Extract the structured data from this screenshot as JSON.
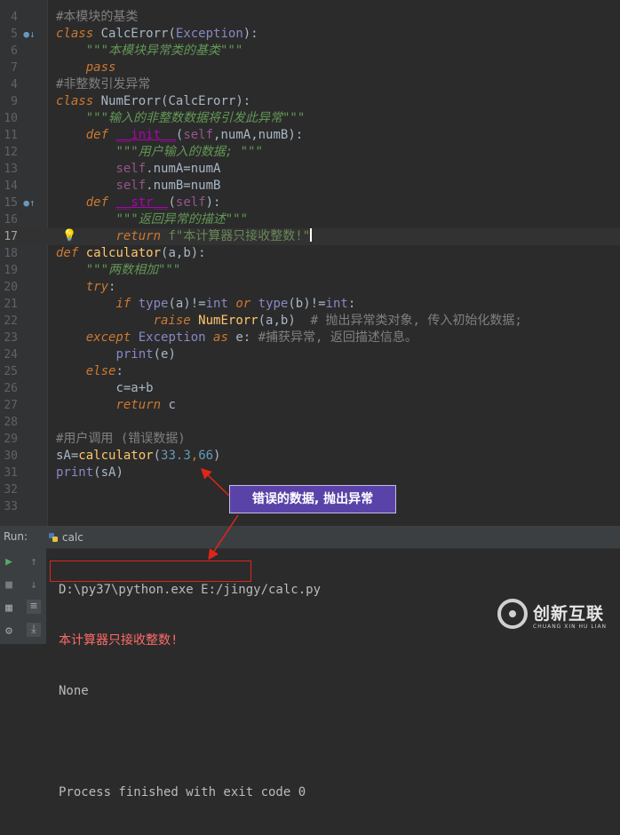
{
  "editor": {
    "line_numbers": [
      "4",
      "5",
      "6",
      "7",
      "4",
      "9",
      "10",
      "11",
      "12",
      "13",
      "14",
      "15",
      "16",
      "17",
      "18",
      "19",
      "20",
      "21",
      "22",
      "23",
      "24",
      "25",
      "26",
      "27",
      "28",
      "29",
      "30",
      "31",
      "32",
      "33"
    ],
    "lines": {
      "l0": {
        "c1": "#本模块的基类"
      },
      "l1": {
        "kw": "class",
        "name": "CalcErorr",
        "p1": "(",
        "base": "Exception",
        "p2": "):"
      },
      "l2": {
        "doc": "\"\"\"本模块异常类的基类\"\"\""
      },
      "l3": {
        "kw": "pass"
      },
      "l4": {
        "c1": "#非整数引发异常"
      },
      "l5": {
        "kw": "class",
        "name": "NumErorr",
        "rest": "(CalcErorr):"
      },
      "l6": {
        "doc": "\"\"\"输入的非整数数据将引发此异常\"\"\""
      },
      "l7": {
        "kw": "def",
        "fn": "__init__",
        "p1": "(",
        "self": "self",
        "rest": ",numA,numB):"
      },
      "l8": {
        "doc": "\"\"\"用户输入的数据; \"\"\""
      },
      "l9": {
        "self": "self",
        "rest": ".numA=numA"
      },
      "l10": {
        "self": "self",
        "rest": ".numB=numB"
      },
      "l11": {
        "kw": "def",
        "fn": "__str__",
        "p1": "(",
        "self": "self",
        "rest": "):"
      },
      "l12": {
        "doc": "\"\"\"返回异常的描述\"\"\""
      },
      "l13": {
        "kw": "return",
        "str": "f\"本计算器只接收整数!\""
      },
      "l14": {
        "kw": "def",
        "fn": "calculator",
        "rest": "(a,b):"
      },
      "l15": {
        "doc": "\"\"\"两数相加\"\"\""
      },
      "l16": {
        "kw": "try",
        "rest": ":"
      },
      "l17": {
        "kw": "if",
        "b1": "type",
        "r1": "(a)!=",
        "b2": "int",
        "kw2": "or",
        "b3": "type",
        "r2": "(b)!=",
        "b4": "int",
        "r3": ":"
      },
      "l18": {
        "kw": "raise",
        "cls": "NumErorr",
        "rest": "(a,b)  ",
        "cmt": "# 抛出异常类对象, 传入初始化数据;"
      },
      "l19": {
        "kw": "except",
        "cls": "Exception",
        "kw2": "as",
        "rest": " e: ",
        "cmt": "#捕获异常, 返回描述信息。"
      },
      "l20": {
        "b1": "print",
        "rest": "(e)"
      },
      "l21": {
        "kw": "else",
        "rest": ":"
      },
      "l22": {
        "rest": "c=a+b"
      },
      "l23": {
        "kw": "return",
        "rest": " c"
      },
      "l25": {
        "c1": "#用户调用 (错误数据)"
      },
      "l26": {
        "var": "sA=",
        "fn": "calculator",
        "p1": "(",
        "n1": "33.3",
        "comma": ",",
        "n2": "66",
        "p2": ")"
      },
      "l27": {
        "b1": "print",
        "rest": "(sA)"
      }
    }
  },
  "run": {
    "label": "Run:",
    "tab": "calc",
    "console": [
      "D:\\py37\\python.exe E:/jingy/calc.py",
      "本计算器只接收整数!",
      "None",
      "",
      "Process finished with exit code 0"
    ]
  },
  "callout": {
    "text": "错误的数据, 抛出异常"
  },
  "watermark": {
    "main": "创新互联",
    "sub": "CHUANG XIN HU LIAN"
  },
  "colors": {
    "keyword": "#cc7832",
    "string": "#6a8759",
    "number": "#6897bb",
    "function": "#ffc66d",
    "annotation": "#e0251b",
    "callout_bg": "#5a43a8"
  }
}
